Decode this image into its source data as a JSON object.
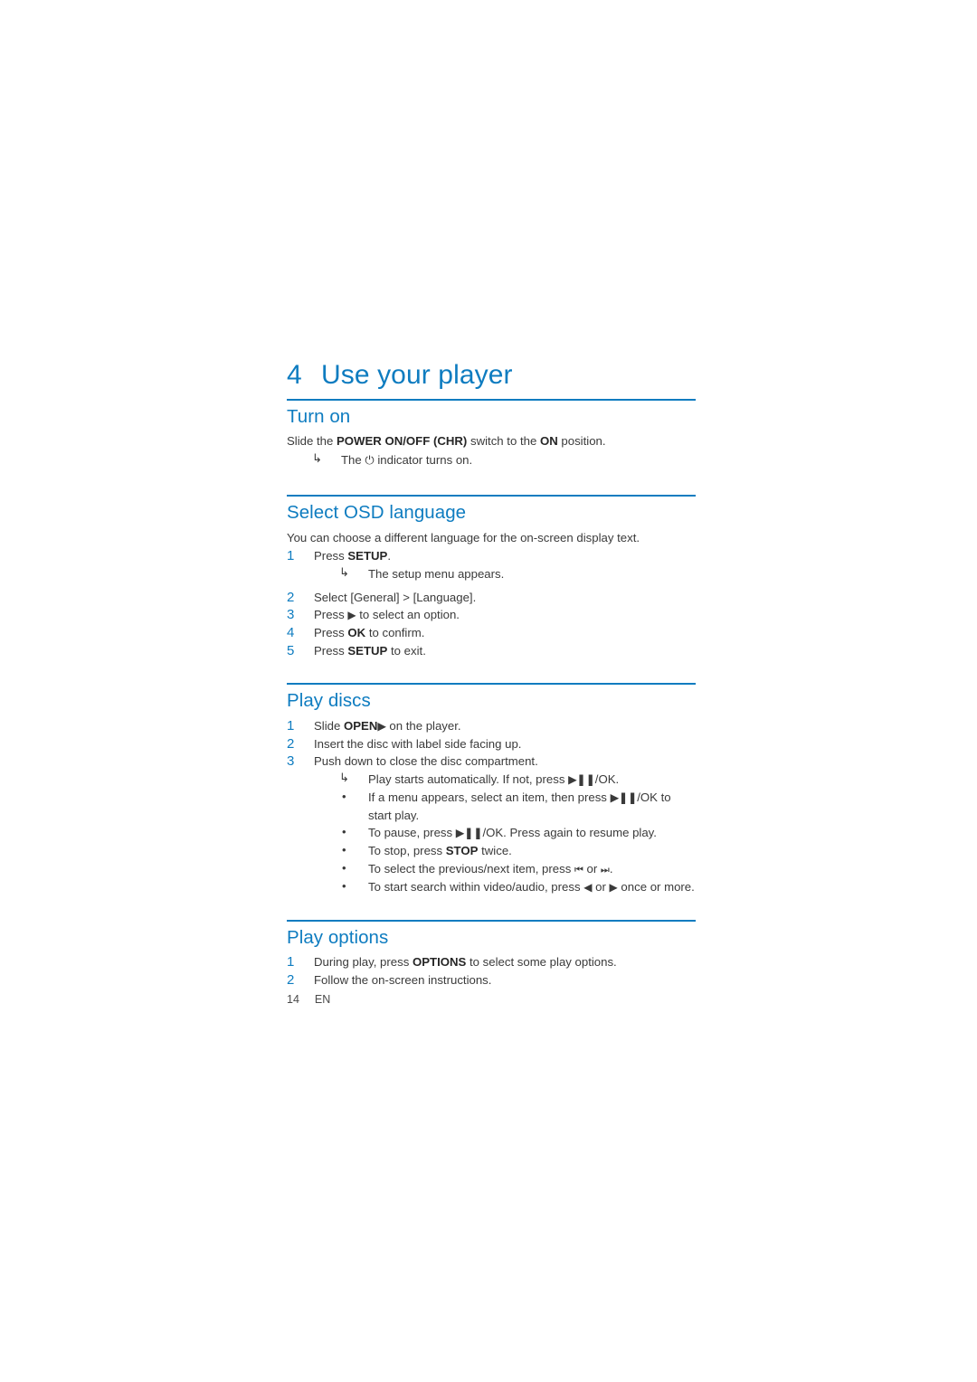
{
  "page": {
    "chapter_number": "4",
    "chapter_title": "Use your player",
    "footer_page_number": "14",
    "footer_language": "EN",
    "accent_color": "#0e7cc0",
    "body_text_color": "#3a3a3a"
  },
  "sections": {
    "turn_on": {
      "heading": "Turn on",
      "intro_prefix": "Slide the ",
      "intro_bold": "POWER ON/OFF (CHR)",
      "intro_mid": " switch to the ",
      "intro_bold2": "ON",
      "intro_suffix": " position.",
      "result_prefix": "The ",
      "result_glyph": "⏻",
      "result_suffix": " indicator turns on."
    },
    "select_osd_language": {
      "heading": "Select OSD language",
      "intro": "You can choose a different language for the on-screen display text.",
      "steps": [
        {
          "num": "1",
          "prefix": "Press ",
          "bold": "SETUP",
          "suffix": "."
        },
        {
          "num": "2",
          "prefix": "Select [General] > [Language].",
          "bold": "",
          "suffix": ""
        },
        {
          "num": "3",
          "prefix": "Press ",
          "glyph": "▶",
          "suffix": " to select an option."
        },
        {
          "num": "4",
          "prefix": "Press ",
          "bold": "OK",
          "suffix": " to confirm."
        },
        {
          "num": "5",
          "prefix": "Press ",
          "bold": "SETUP",
          "suffix": " to exit."
        }
      ],
      "step1_result": "The setup menu appears."
    },
    "play_discs": {
      "heading": "Play discs",
      "steps": [
        {
          "num": "1",
          "prefix": "Slide ",
          "bold": "OPEN",
          "glyph": "▶",
          "suffix": " on the player."
        },
        {
          "num": "2",
          "text": "Insert the disc with label side facing up."
        },
        {
          "num": "3",
          "text": "Push down to close the disc compartment."
        }
      ],
      "result": {
        "prefix": "Play starts automatically. If not, press ",
        "glyph": "▶❚❚",
        "suffix": "/OK."
      },
      "bullets": [
        {
          "prefix": "If a menu appears, select an item, then press ",
          "glyph": "▶❚❚",
          "suffix": "/OK to start play."
        },
        {
          "prefix": "To pause, press ",
          "glyph": "▶❚❚",
          "suffix": "/OK. Press again to resume play."
        },
        {
          "prefix": "To stop, press ",
          "bold": "STOP",
          "suffix": " twice."
        },
        {
          "prefix": "To select the previous/next item, press ",
          "glyph": "⏮",
          "mid": " or ",
          "glyph2": "⏭",
          "suffix": "."
        },
        {
          "prefix": "To start search within video/audio, press ",
          "glyph": "◀",
          "mid": " or ",
          "glyph2": "▶",
          "suffix": " once or more."
        }
      ]
    },
    "play_options": {
      "heading": "Play options",
      "steps": [
        {
          "num": "1",
          "prefix": "During play, press ",
          "bold": "OPTIONS",
          "suffix": " to select some play options."
        },
        {
          "num": "2",
          "text": "Follow the on-screen instructions."
        }
      ]
    }
  }
}
